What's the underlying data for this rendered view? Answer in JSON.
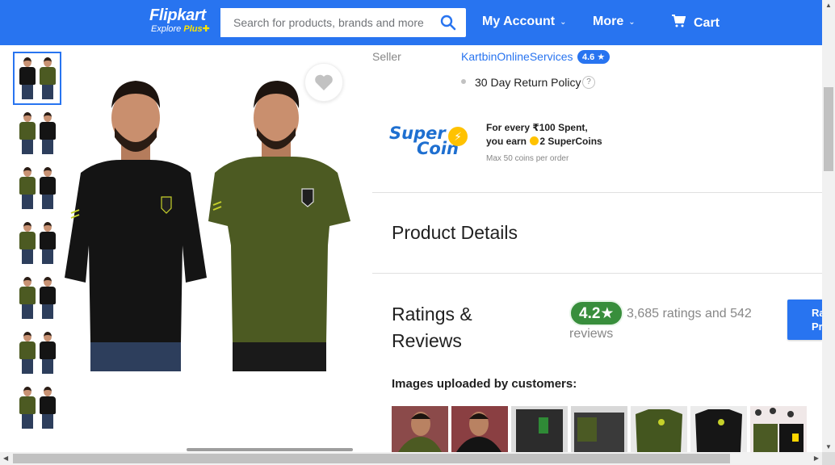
{
  "header": {
    "brand": "Flipkart",
    "tagline_prefix": "Explore ",
    "tagline_plus": "Plus",
    "search_placeholder": "Search for products, brands and more",
    "my_account": "My Account",
    "more": "More",
    "cart": "Cart",
    "color": "#2874f0"
  },
  "gallery": {
    "thumbnail_count": 7,
    "active_index": 0
  },
  "seller": {
    "label": "Seller",
    "name": "KartbinOnlineServices",
    "rating": "4.6",
    "policy": "30 Day Return Policy",
    "help": "?"
  },
  "supercoin": {
    "logo_line1": "Super",
    "logo_line2": "Coin",
    "line1": "For every ₹100 Spent,",
    "line2_prefix": "you earn ",
    "line2_suffix": "2 SuperCoins",
    "max": "Max 50 coins per order"
  },
  "product_details": {
    "title": "Product Details"
  },
  "ratings": {
    "title": "Ratings & Reviews",
    "score": "4.2",
    "star": "★",
    "count_line1": "3,685 ratings and 542",
    "count_line2": "reviews",
    "rate_button": "Rate Product",
    "customer_images_title": "Images uploaded by customers:"
  },
  "colors": {
    "accent": "#2874f0",
    "rating_green": "#388e3c",
    "shirt_black": "#141414",
    "shirt_olive": "#4c5a22"
  }
}
